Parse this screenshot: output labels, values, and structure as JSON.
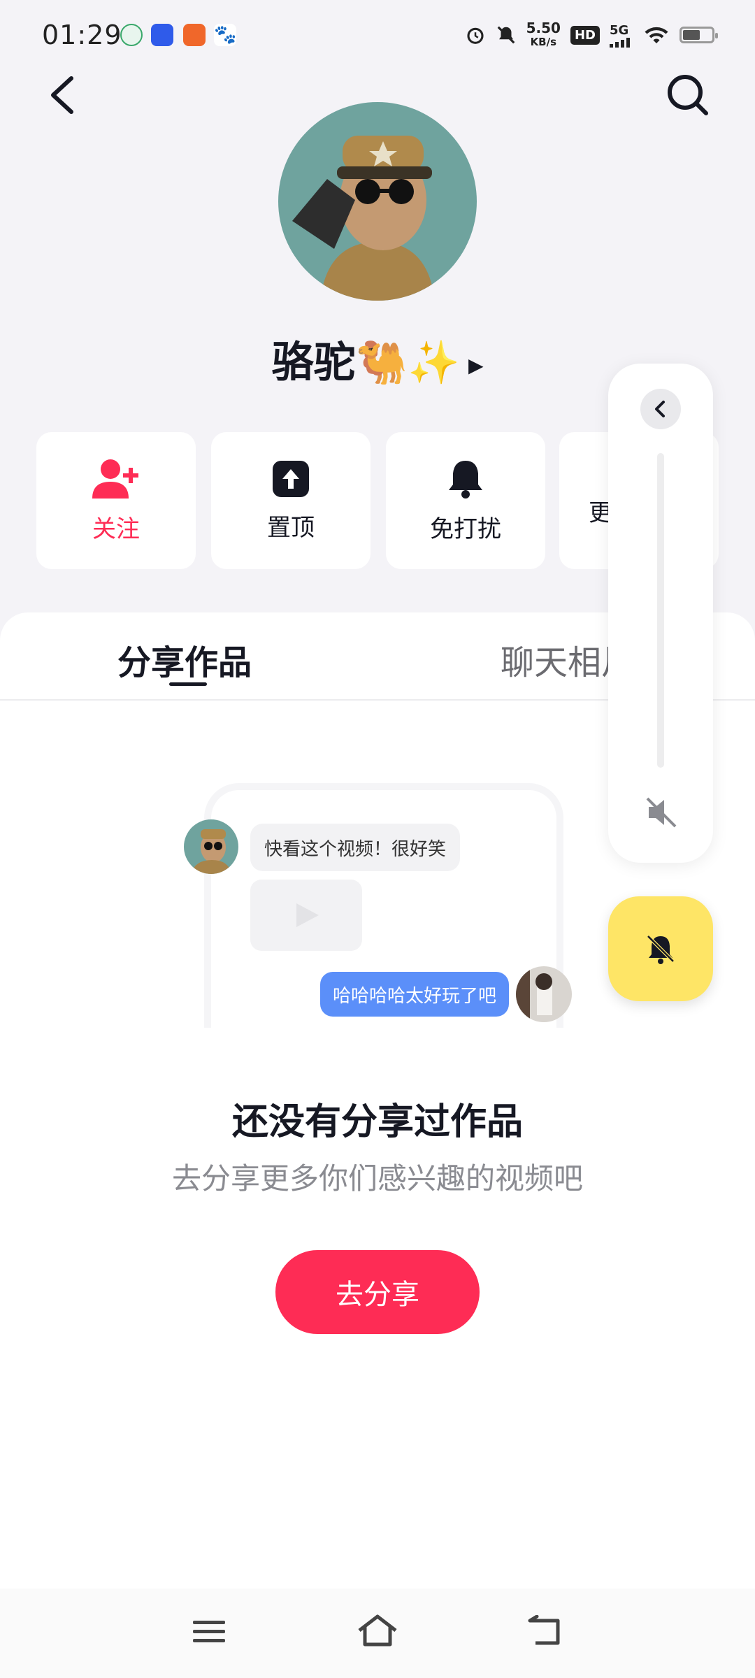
{
  "status_bar": {
    "time": "01:29",
    "net_speed_value": "5.50",
    "net_speed_unit": "KB/s",
    "hd": "HD",
    "network": "5G",
    "battery_level": 0.55
  },
  "profile": {
    "nickname": "骆驼🐫✨"
  },
  "actions": [
    {
      "label": "关注"
    },
    {
      "label": "置顶"
    },
    {
      "label": "免打扰"
    },
    {
      "label": "更"
    }
  ],
  "tabs": [
    {
      "label": "分享作品"
    },
    {
      "label": "聊天相片"
    }
  ],
  "illustration": {
    "bubble_received": "快看这个视频！很好笑",
    "bubble_sent": "哈哈哈哈太好玩了吧"
  },
  "empty_state": {
    "title": "还没有分享过作品",
    "subtitle": "去分享更多你们感兴趣的视频吧",
    "button_label": "去分享"
  },
  "colors": {
    "accent": "#fe2c55",
    "fab": "#fee566",
    "sent_bubble": "#5b8ff9"
  }
}
